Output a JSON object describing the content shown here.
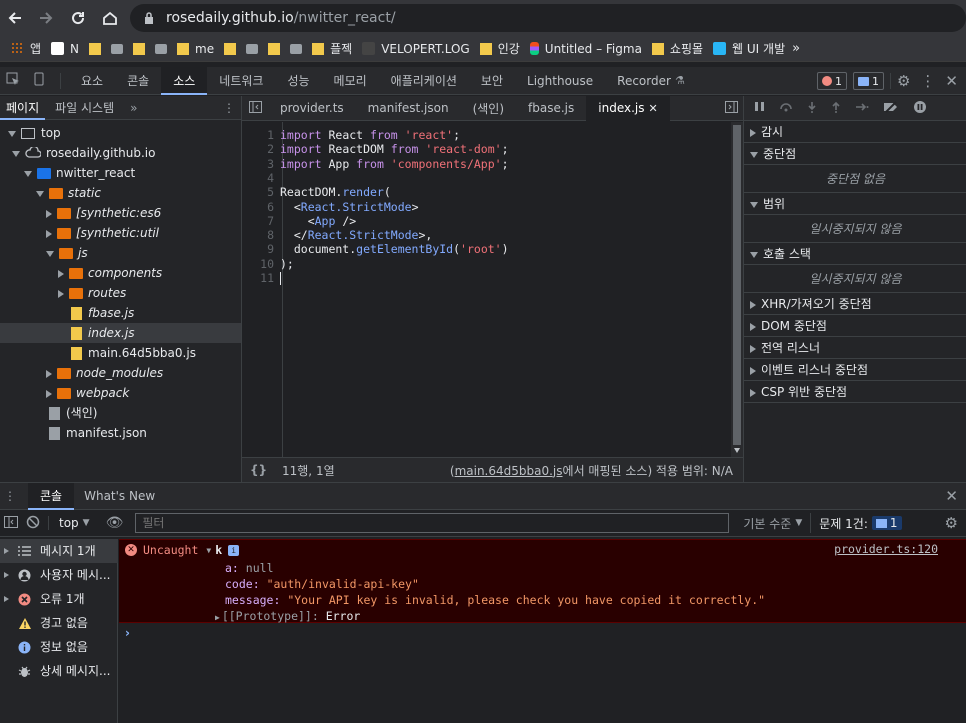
{
  "browser": {
    "url_host": "rosedaily.github.io",
    "url_path": "/nwitter_react/",
    "bookmarks": [
      {
        "label": "앱",
        "icon": "apps-icon"
      },
      {
        "label": "N",
        "icon": "notion-icon"
      },
      {
        "label": "",
        "icon": "folder-icon"
      },
      {
        "label": "",
        "icon": "laptop-icon"
      },
      {
        "label": "",
        "icon": "folder-icon"
      },
      {
        "label": "",
        "icon": "tv-icon"
      },
      {
        "label": "me",
        "icon": "folder-icon"
      },
      {
        "label": "",
        "icon": "folder-icon"
      },
      {
        "label": "",
        "icon": "sparkle-icon"
      },
      {
        "label": "",
        "icon": "folder-icon"
      },
      {
        "label": "",
        "icon": "book-icon"
      },
      {
        "label": "플젝",
        "icon": "folder-icon"
      },
      {
        "label": "VELOPERT.LOG",
        "icon": "velopert-icon"
      },
      {
        "label": "인강",
        "icon": "folder-icon"
      },
      {
        "label": "Untitled – Figma",
        "icon": "figma-icon"
      },
      {
        "label": "쇼핑몰",
        "icon": "folder-icon"
      },
      {
        "label": "웹 UI 개발",
        "icon": "web-icon"
      }
    ]
  },
  "devtools": {
    "tabs": [
      "요소",
      "콘솔",
      "소스",
      "네트워크",
      "성능",
      "메모리",
      "애플리케이션",
      "보안",
      "Lighthouse",
      "Recorder"
    ],
    "active_tab": "소스",
    "error_count": "1",
    "message_count": "1"
  },
  "navigator": {
    "tabs": [
      "페이지",
      "파일 시스템"
    ],
    "tree": [
      {
        "label": "top",
        "depth": 0
      },
      {
        "label": "rosedaily.github.io",
        "depth": 1
      },
      {
        "label": "nwitter_react",
        "depth": 2
      },
      {
        "label": "static",
        "depth": 3
      },
      {
        "label": "[synthetic:es6",
        "depth": 4
      },
      {
        "label": "[synthetic:util",
        "depth": 4
      },
      {
        "label": "js",
        "depth": 4
      },
      {
        "label": "components",
        "depth": 5
      },
      {
        "label": "routes",
        "depth": 5
      },
      {
        "label": "fbase.js",
        "depth": 5
      },
      {
        "label": "index.js",
        "depth": 5
      },
      {
        "label": "main.64d5bba0.js",
        "depth": 5
      },
      {
        "label": "node_modules",
        "depth": 4
      },
      {
        "label": "webpack",
        "depth": 4
      },
      {
        "label": "(색인)",
        "depth": 3
      },
      {
        "label": "manifest.json",
        "depth": 3
      }
    ]
  },
  "editor": {
    "tabs": [
      "provider.ts",
      "manifest.json",
      "(색인)",
      "fbase.js",
      "index.js"
    ],
    "active_tab": "index.js",
    "status_position": "11행, 1열",
    "status_source_link": "main.64d5bba0.js",
    "status_source_suffix": "에서 매핑된 소스) 적용 범위: N/A",
    "status_source_prefix": "("
  },
  "debugger": {
    "sections": [
      {
        "label": "감시",
        "expanded": false
      },
      {
        "label": "중단점",
        "expanded": true,
        "body": "중단점 없음"
      },
      {
        "label": "범위",
        "expanded": true,
        "body": "일시중지되지 않음"
      },
      {
        "label": "호출 스택",
        "expanded": true,
        "body": "일시중지되지 않음"
      },
      {
        "label": "XHR/가져오기 중단점",
        "expanded": false
      },
      {
        "label": "DOM 중단점",
        "expanded": false
      },
      {
        "label": "전역 리스너",
        "expanded": false
      },
      {
        "label": "이벤트 리스너 중단점",
        "expanded": false
      },
      {
        "label": "CSP 위반 중단점",
        "expanded": false
      }
    ]
  },
  "console": {
    "tabs": [
      "콘솔",
      "What's New"
    ],
    "context": "top",
    "filter_placeholder": "필터",
    "level": "기본 수준",
    "issues_label": "문제 1건:",
    "issues_count": "1",
    "sidebar": [
      {
        "label": "메시지 1개",
        "icon": "list-icon"
      },
      {
        "label": "사용자 메시...",
        "icon": "user-icon"
      },
      {
        "label": "오류 1개",
        "icon": "error-icon"
      },
      {
        "label": "경고 없음",
        "icon": "warning-icon"
      },
      {
        "label": "정보 없음",
        "icon": "info-icon"
      },
      {
        "label": "상세 메시지...",
        "icon": "bug-icon"
      }
    ],
    "error": {
      "prefix": "Uncaught",
      "object_name": "k",
      "source": "provider.ts:120",
      "a_key": "a:",
      "a_val": "null",
      "code_key": "code:",
      "code_val": "\"auth/invalid-api-key\"",
      "message_key": "message:",
      "message_val": "\"Your API key is invalid, please check you have copied it correctly.\"",
      "proto_key": "[[Prototype]]:",
      "proto_val": "Error"
    },
    "prompt": "›"
  },
  "colors": {
    "accent": "#8ab4f8",
    "error_bg": "#290000",
    "error_text": "#f28b82",
    "string": "#f07178",
    "keyword": "#c792ea"
  }
}
